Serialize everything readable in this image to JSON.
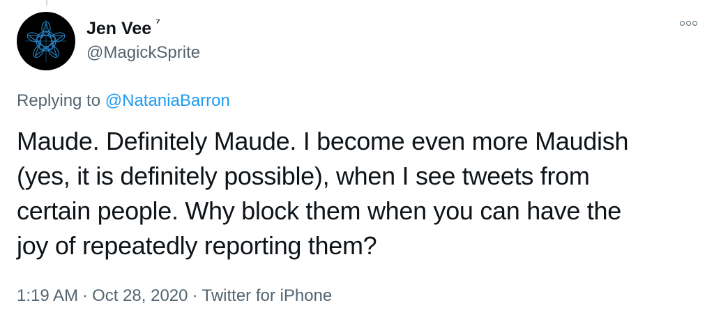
{
  "tweet": {
    "author": {
      "display_name": "Jen Vee",
      "badge": "⁷",
      "handle": "@MagickSprite",
      "avatar_icon": "geometric-star-avatar"
    },
    "replying": {
      "prefix": "Replying to ",
      "mention": "@NataniaBarron"
    },
    "text": "Maude. Definitely Maude. I become even more Maudish\n(yes, it is definitely possible), when I see tweets from\ncertain people. Why block them when you can have the\njoy of repeatedly reporting them?",
    "meta": {
      "time": "1:19 AM",
      "separator": "·",
      "date": "Oct 28, 2020",
      "source": "Twitter for iPhone"
    },
    "more_icon": "more-horizontal-icon"
  },
  "colors": {
    "text_primary": "#0f1419",
    "text_secondary": "#536471",
    "link": "#1d9bf0",
    "avatar_bg": "#000000",
    "avatar_pattern": "#2a8fd6"
  }
}
